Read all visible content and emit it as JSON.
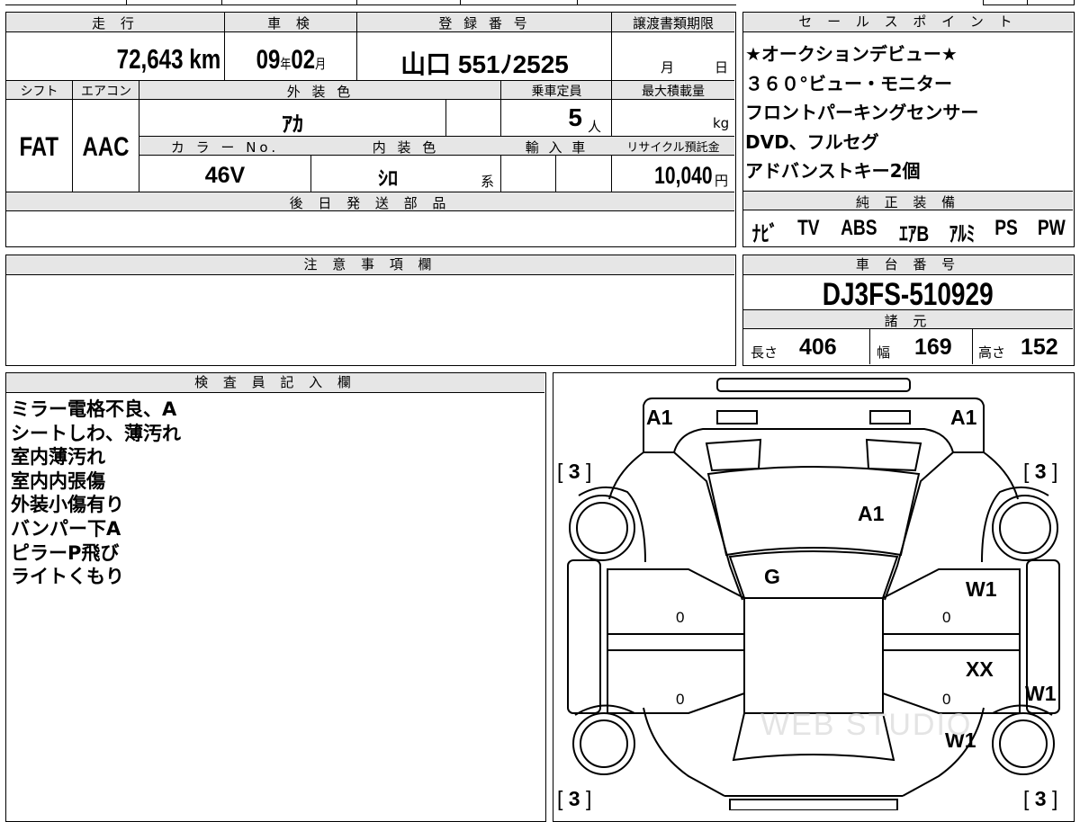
{
  "vehicle_info": {
    "mileage": {
      "label": "走 行",
      "value": "72,643",
      "unit": "km"
    },
    "inspection": {
      "label": "車 検",
      "year": "09",
      "year_unit": "年",
      "month": "02",
      "month_unit": "月"
    },
    "registration": {
      "label": "登 録 番 号",
      "value": "山口 551ﾉ2525"
    },
    "transfer_deadline": {
      "label": "譲渡書類期限",
      "month_unit": "月",
      "day_unit": "日"
    },
    "shift": {
      "label": "シフト",
      "value": "FAT"
    },
    "aircon": {
      "label": "エアコン",
      "value": "AAC"
    },
    "exterior_color": {
      "label": "外 装 色",
      "value": "ｱｶ"
    },
    "capacity": {
      "label": "乗車定員",
      "value": "5",
      "unit": "人"
    },
    "max_load": {
      "label": "最大積載量",
      "unit": "kg"
    },
    "color_no": {
      "label": "カ ラ ー No.",
      "value": "46V"
    },
    "interior_color": {
      "label": "内 装 色",
      "value": "ｼﾛ",
      "suffix": "系"
    },
    "import": {
      "label": "輸 入 車"
    },
    "recycle_fee": {
      "label": "リサイクル預託金",
      "value": "10,040",
      "unit": "円"
    },
    "later_parts": {
      "label": "後 日 発 送 部 品"
    }
  },
  "sales_points": {
    "label": "セ ー ル ス ポ イ ン ト",
    "lines": [
      "★オークションデビュー★",
      "３６０°ビュー・モニター",
      "フロントパーキングセンサー",
      "DVD、フルセグ",
      "アドバンストキー2個"
    ]
  },
  "equipment": {
    "label": "純 正 装 備",
    "items": [
      "ﾅﾋﾞ",
      "TV",
      "ABS",
      "ｴｱB",
      "ｱﾙﾐ",
      "PS",
      "PW"
    ]
  },
  "caution": {
    "label": "注 意 事 項 欄"
  },
  "chassis": {
    "label": "車 台 番 号",
    "value": "DJ3FS-510929"
  },
  "specs": {
    "label": "諸 元",
    "length_label": "長さ",
    "length": "406",
    "width_label": "幅",
    "width": "169",
    "height_label": "高さ",
    "height": "152"
  },
  "inspector_notes": {
    "label": "検 査 員 記 入 欄",
    "lines": [
      "ミラー電格不良、A",
      "シートしわ、薄汚れ",
      "室内薄汚れ",
      "室内内張傷",
      "外装小傷有り",
      "バンパー下A",
      "ピラーP飛び",
      "ライトくもり"
    ]
  },
  "diagram": {
    "mirror_left": "A1",
    "mirror_right": "A1",
    "windshield": "A1",
    "roof": "G",
    "front_right_door": "W1",
    "rear_right_door": "XX",
    "rear_right_fender": "W1",
    "right_rocker": "W1",
    "front_left_tire": "3",
    "front_right_tire": "3",
    "rear_left_tire": "3",
    "rear_right_tire": "3",
    "door_markers": [
      "0",
      "0",
      "0",
      "0"
    ],
    "watermark": "WEB STUDIO"
  }
}
